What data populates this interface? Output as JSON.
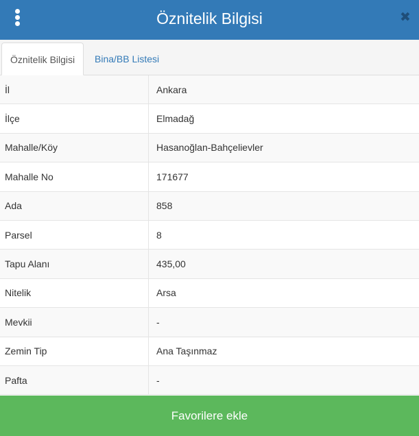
{
  "header": {
    "title": "Öznitelik Bilgisi",
    "menu_icon": "vertical-ellipsis-icon",
    "close_icon": "close-icon",
    "close_glyph": "✖"
  },
  "tabs": [
    {
      "label": "Öznitelik Bilgisi",
      "active": true
    },
    {
      "label": "Bina/BB Listesi",
      "active": false
    }
  ],
  "attributes": [
    {
      "key": "İl",
      "value": "Ankara"
    },
    {
      "key": "İlçe",
      "value": "Elmadağ"
    },
    {
      "key": "Mahalle/Köy",
      "value": "Hasanoğlan-Bahçelievler"
    },
    {
      "key": "Mahalle No",
      "value": "171677"
    },
    {
      "key": "Ada",
      "value": "858"
    },
    {
      "key": "Parsel",
      "value": "8"
    },
    {
      "key": "Tapu Alanı",
      "value": "435,00"
    },
    {
      "key": "Nitelik",
      "value": "Arsa"
    },
    {
      "key": "Mevkii",
      "value": "-"
    },
    {
      "key": "Zemin Tip",
      "value": "Ana Taşınmaz"
    },
    {
      "key": "Pafta",
      "value": "-"
    }
  ],
  "footer": {
    "favorite_label": "Favorilere ekle"
  },
  "colors": {
    "header": "#337ab7",
    "button": "#5cb85c",
    "link": "#337ab7"
  }
}
